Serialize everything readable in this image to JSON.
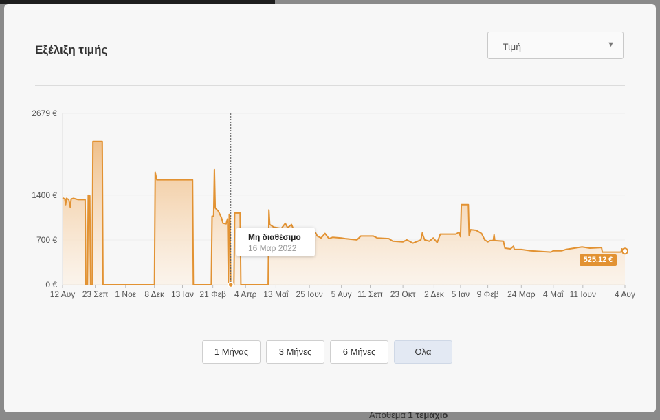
{
  "modal": {
    "title": "Εξέλιξη τιμής",
    "metric_select": {
      "value": "Τιμή",
      "arrow": "▼"
    }
  },
  "tooltip": {
    "title": "Μη διαθέσιμο",
    "date": "16 Μαρ 2022"
  },
  "current_price_label": "525.12 €",
  "range_buttons": [
    {
      "label": "1 Μήνας",
      "active": false
    },
    {
      "label": "3 Μήνες",
      "active": false
    },
    {
      "label": "6 Μήνες",
      "active": false
    },
    {
      "label": "Όλα",
      "active": true
    }
  ],
  "background_text": {
    "prefix": "Απόθεμα ",
    "bold": "1 τεμάχιο"
  },
  "colors": {
    "line": "#e29232",
    "fill_top": "#efbd85",
    "grid": "#eeeeee",
    "active_button": "#e3e9f3"
  },
  "chart_data": {
    "type": "area",
    "title": "",
    "xlabel": "",
    "ylabel": "",
    "ylim": [
      0,
      2679
    ],
    "y_ticks": [
      {
        "value": 0,
        "label": "0 €"
      },
      {
        "value": 700,
        "label": "700 €"
      },
      {
        "value": 1400,
        "label": "1400 €"
      },
      {
        "value": 2679,
        "label": "2679 €"
      }
    ],
    "x_ticks": [
      {
        "date": "2021-08-12",
        "label": "12 Αυγ"
      },
      {
        "date": "2021-09-23",
        "label": "23 Σεπ"
      },
      {
        "date": "2021-11-01",
        "label": "1 Νοε"
      },
      {
        "date": "2021-12-08",
        "label": "8 Δεκ"
      },
      {
        "date": "2022-01-13",
        "label": "13 Ιαν"
      },
      {
        "date": "2022-02-21",
        "label": "21 Φεβ"
      },
      {
        "date": "2022-04-04",
        "label": "4 Απρ"
      },
      {
        "date": "2022-05-13",
        "label": "13 Μαΐ"
      },
      {
        "date": "2022-06-25",
        "label": "25 Ιουν"
      },
      {
        "date": "2022-08-05",
        "label": "5 Αυγ"
      },
      {
        "date": "2022-09-11",
        "label": "11 Σεπ"
      },
      {
        "date": "2022-10-23",
        "label": "23 Οκτ"
      },
      {
        "date": "2022-12-02",
        "label": "2 Δεκ"
      },
      {
        "date": "2023-01-05",
        "label": "5 Ιαν"
      },
      {
        "date": "2023-02-09",
        "label": "9 Φεβ"
      },
      {
        "date": "2023-03-24",
        "label": "24 Μαρ"
      },
      {
        "date": "2023-05-04",
        "label": "4 Μαΐ"
      },
      {
        "date": "2023-06-11",
        "label": "11 Ιουν"
      },
      {
        "date": "2023-08-04",
        "label": "4 Αυγ"
      }
    ],
    "grid": true,
    "tooltip_date": "2022-03-16",
    "series": [
      {
        "points": [
          [
            "2021-08-12",
            1360
          ],
          [
            "2021-08-15",
            1340
          ],
          [
            "2021-08-16",
            1250
          ],
          [
            "2021-08-17",
            1350
          ],
          [
            "2021-08-20",
            1330
          ],
          [
            "2021-08-22",
            1210
          ],
          [
            "2021-08-23",
            1340
          ],
          [
            "2021-08-26",
            1350
          ],
          [
            "2021-09-01",
            1330
          ],
          [
            "2021-09-10",
            1330
          ],
          [
            "2021-09-11",
            0
          ],
          [
            "2021-09-13",
            0
          ],
          [
            "2021-09-14",
            1400
          ],
          [
            "2021-09-16",
            1390
          ],
          [
            "2021-09-17",
            0
          ],
          [
            "2021-09-19",
            0
          ],
          [
            "2021-09-20",
            2240
          ],
          [
            "2021-10-02",
            2240
          ],
          [
            "2021-10-03",
            0
          ],
          [
            "2021-12-08",
            0
          ],
          [
            "2021-12-09",
            1760
          ],
          [
            "2021-12-11",
            1640
          ],
          [
            "2022-01-26",
            1640
          ],
          [
            "2022-01-27",
            0
          ],
          [
            "2022-02-19",
            0
          ],
          [
            "2022-02-20",
            1070
          ],
          [
            "2022-02-22",
            1070
          ],
          [
            "2022-02-23",
            1800
          ],
          [
            "2022-02-24",
            1200
          ],
          [
            "2022-02-28",
            1150
          ],
          [
            "2022-03-02",
            1100
          ],
          [
            "2022-03-04",
            1050
          ],
          [
            "2022-03-06",
            960
          ],
          [
            "2022-03-10",
            950
          ],
          [
            "2022-03-11",
            1000
          ],
          [
            "2022-03-12",
            1030
          ],
          [
            "2022-03-13",
            0
          ],
          [
            "2022-03-14",
            1100
          ],
          [
            "2022-03-15",
            1070
          ],
          [
            "2022-03-16",
            0
          ],
          [
            "2022-03-20",
            0
          ],
          [
            "2022-03-21",
            1120
          ],
          [
            "2022-03-28",
            1120
          ],
          [
            "2022-03-29",
            0
          ],
          [
            "2022-05-03",
            0
          ],
          [
            "2022-05-04",
            1170
          ],
          [
            "2022-05-05",
            940
          ],
          [
            "2022-05-10",
            900
          ],
          [
            "2022-05-20",
            880
          ],
          [
            "2022-05-25",
            960
          ],
          [
            "2022-05-28",
            890
          ],
          [
            "2022-06-02",
            940
          ],
          [
            "2022-06-05",
            850
          ],
          [
            "2022-06-15",
            820
          ],
          [
            "2022-06-30",
            780
          ],
          [
            "2022-07-03",
            810
          ],
          [
            "2022-07-05",
            760
          ],
          [
            "2022-07-10",
            730
          ],
          [
            "2022-07-15",
            800
          ],
          [
            "2022-07-20",
            720
          ],
          [
            "2022-07-25",
            740
          ],
          [
            "2022-08-05",
            730
          ],
          [
            "2022-08-10",
            720
          ],
          [
            "2022-08-25",
            700
          ],
          [
            "2022-08-30",
            760
          ],
          [
            "2022-09-15",
            760
          ],
          [
            "2022-09-20",
            730
          ],
          [
            "2022-10-05",
            720
          ],
          [
            "2022-10-10",
            680
          ],
          [
            "2022-10-23",
            670
          ],
          [
            "2022-10-28",
            700
          ],
          [
            "2022-11-05",
            650
          ],
          [
            "2022-11-15",
            700
          ],
          [
            "2022-11-17",
            810
          ],
          [
            "2022-11-18",
            760
          ],
          [
            "2022-11-20",
            700
          ],
          [
            "2022-11-26",
            680
          ],
          [
            "2022-12-01",
            730
          ],
          [
            "2022-12-06",
            660
          ],
          [
            "2022-12-10",
            790
          ],
          [
            "2022-12-30",
            790
          ],
          [
            "2023-01-03",
            820
          ],
          [
            "2023-01-05",
            750
          ],
          [
            "2023-01-06",
            1250
          ],
          [
            "2023-01-15",
            1250
          ],
          [
            "2023-01-16",
            770
          ],
          [
            "2023-01-18",
            860
          ],
          [
            "2023-01-25",
            850
          ],
          [
            "2023-02-01",
            800
          ],
          [
            "2023-02-05",
            700
          ],
          [
            "2023-02-09",
            670
          ],
          [
            "2023-02-12",
            690
          ],
          [
            "2023-02-16",
            690
          ],
          [
            "2023-02-17",
            780
          ],
          [
            "2023-02-18",
            690
          ],
          [
            "2023-03-01",
            680
          ],
          [
            "2023-03-03",
            570
          ],
          [
            "2023-03-10",
            560
          ],
          [
            "2023-03-14",
            600
          ],
          [
            "2023-03-15",
            550
          ],
          [
            "2023-03-24",
            550
          ],
          [
            "2023-04-05",
            530
          ],
          [
            "2023-05-01",
            510
          ],
          [
            "2023-05-04",
            530
          ],
          [
            "2023-05-15",
            530
          ],
          [
            "2023-05-20",
            550
          ],
          [
            "2023-06-10",
            590
          ],
          [
            "2023-06-20",
            570
          ],
          [
            "2023-07-05",
            580
          ],
          [
            "2023-07-06",
            510
          ],
          [
            "2023-07-30",
            510
          ],
          [
            "2023-07-31",
            560
          ],
          [
            "2023-08-01",
            525.12
          ],
          [
            "2023-08-04",
            525.12
          ]
        ]
      }
    ]
  }
}
